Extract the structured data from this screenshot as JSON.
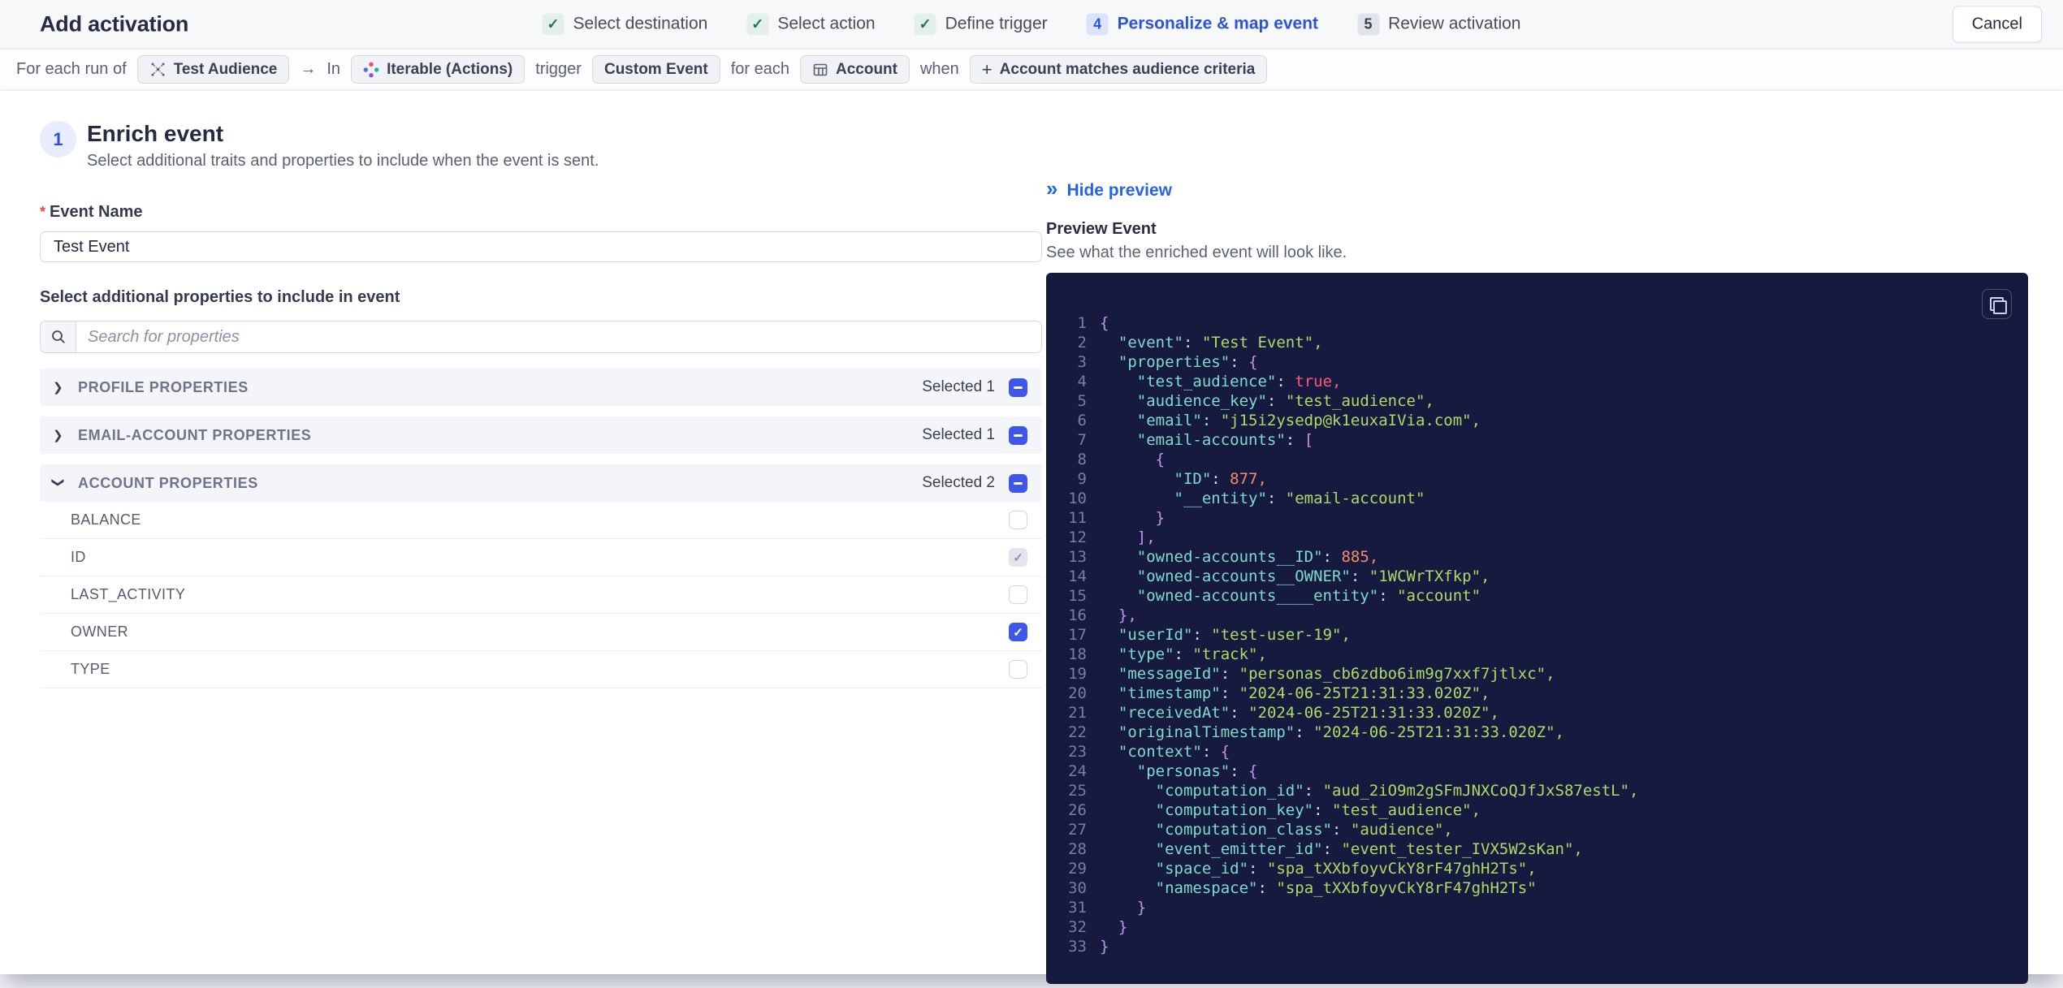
{
  "colors": {
    "accent_blue": "#2b54d8",
    "link_blue": "#2563ea",
    "checkbox_blue": "#3e56ea",
    "success_green": "#1e7a4e",
    "required_red": "#e5484d",
    "code_background": "#161a3e",
    "code_key": "#7fdbca",
    "code_string": "#addb67",
    "code_punctuation": "#c792ea",
    "code_number": "#f78c6c",
    "code_boolean": "#ff5874"
  },
  "header": {
    "title": "Add activation",
    "cancel_label": "Cancel",
    "steps": [
      {
        "label": "Select destination",
        "state": "done"
      },
      {
        "label": "Select action",
        "state": "done"
      },
      {
        "label": "Define trigger",
        "state": "done"
      },
      {
        "label": "Personalize & map event",
        "state": "active",
        "number": "4"
      },
      {
        "label": "Review activation",
        "state": "upcoming",
        "number": "5"
      }
    ]
  },
  "breadcrumb": {
    "segments": [
      {
        "type": "text",
        "text": "For each run of"
      },
      {
        "type": "chip",
        "text": "Test Audience",
        "icon": "audience-icon"
      },
      {
        "type": "text",
        "text": "→"
      },
      {
        "type": "text",
        "text": "In"
      },
      {
        "type": "chip",
        "text": "Iterable (Actions)",
        "icon": "iterable-icon"
      },
      {
        "type": "text",
        "text": "trigger"
      },
      {
        "type": "chip",
        "text": "Custom Event"
      },
      {
        "type": "text",
        "text": "for each"
      },
      {
        "type": "chip",
        "text": "Account",
        "icon": "table-icon"
      },
      {
        "type": "text",
        "text": "when"
      },
      {
        "type": "chip",
        "text": "Account matches audience criteria",
        "icon": "plus-icon"
      }
    ]
  },
  "enrich": {
    "step_number": "1",
    "required_mark": "*",
    "title": "Enrich event",
    "subtitle": "Select additional traits and properties to include when the event is sent.",
    "event_name_label": "Event Name",
    "event_name_value": "Test Event",
    "properties_label": "Select additional properties to include in event",
    "search_placeholder": "Search for properties",
    "sections": [
      {
        "label": "PROFILE PROPERTIES",
        "selected_text": "Selected 1",
        "expanded": false
      },
      {
        "label": "EMAIL-ACCOUNT PROPERTIES",
        "selected_text": "Selected 1",
        "expanded": false
      },
      {
        "label": "ACCOUNT PROPERTIES",
        "selected_text": "Selected 2",
        "expanded": true,
        "properties": [
          {
            "label": "BALANCE",
            "checked": false,
            "disabled": false
          },
          {
            "label": "ID",
            "checked": true,
            "disabled": true
          },
          {
            "label": "LAST_ACTIVITY",
            "checked": false,
            "disabled": false
          },
          {
            "label": "OWNER",
            "checked": true,
            "disabled": false
          },
          {
            "label": "TYPE",
            "checked": false,
            "disabled": false
          }
        ]
      }
    ]
  },
  "preview": {
    "hide_label": "Hide preview",
    "title": "Preview Event",
    "subtitle": "See what the enriched event will look like.",
    "code_lines": [
      [
        [
          "p",
          "{"
        ]
      ],
      [
        [
          "w",
          "  "
        ],
        [
          "k",
          "\"event\""
        ],
        [
          "w",
          ": "
        ],
        [
          "s",
          "\"Test Event\","
        ]
      ],
      [
        [
          "w",
          "  "
        ],
        [
          "k",
          "\"properties\""
        ],
        [
          "w",
          ": "
        ],
        [
          "p",
          "{"
        ]
      ],
      [
        [
          "w",
          "    "
        ],
        [
          "k",
          "\"test_audience\""
        ],
        [
          "w",
          ": "
        ],
        [
          "b",
          "true,"
        ]
      ],
      [
        [
          "w",
          "    "
        ],
        [
          "k",
          "\"audience_key\""
        ],
        [
          "w",
          ": "
        ],
        [
          "s",
          "\"test_audience\","
        ]
      ],
      [
        [
          "w",
          "    "
        ],
        [
          "k",
          "\"email\""
        ],
        [
          "w",
          ": "
        ],
        [
          "s",
          "\"j15i2ysedp@k1euxaIVia.com\","
        ]
      ],
      [
        [
          "w",
          "    "
        ],
        [
          "k",
          "\"email-accounts\""
        ],
        [
          "w",
          ": "
        ],
        [
          "p",
          "["
        ]
      ],
      [
        [
          "w",
          "      "
        ],
        [
          "p",
          "{"
        ]
      ],
      [
        [
          "w",
          "        "
        ],
        [
          "k",
          "\"ID\""
        ],
        [
          "w",
          ": "
        ],
        [
          "n",
          "877,"
        ]
      ],
      [
        [
          "w",
          "        "
        ],
        [
          "k",
          "\"__entity\""
        ],
        [
          "w",
          ": "
        ],
        [
          "s",
          "\"email-account\""
        ]
      ],
      [
        [
          "w",
          "      "
        ],
        [
          "p",
          "}"
        ]
      ],
      [
        [
          "w",
          "    "
        ],
        [
          "p",
          "],"
        ]
      ],
      [
        [
          "w",
          "    "
        ],
        [
          "k",
          "\"owned-accounts__ID\""
        ],
        [
          "w",
          ": "
        ],
        [
          "n",
          "885,"
        ]
      ],
      [
        [
          "w",
          "    "
        ],
        [
          "k",
          "\"owned-accounts__OWNER\""
        ],
        [
          "w",
          ": "
        ],
        [
          "s",
          "\"1WCWrTXfkp\","
        ]
      ],
      [
        [
          "w",
          "    "
        ],
        [
          "k",
          "\"owned-accounts____entity\""
        ],
        [
          "w",
          ": "
        ],
        [
          "s",
          "\"account\""
        ]
      ],
      [
        [
          "w",
          "  "
        ],
        [
          "p",
          "},"
        ]
      ],
      [
        [
          "w",
          "  "
        ],
        [
          "k",
          "\"userId\""
        ],
        [
          "w",
          ": "
        ],
        [
          "s",
          "\"test-user-19\","
        ]
      ],
      [
        [
          "w",
          "  "
        ],
        [
          "k",
          "\"type\""
        ],
        [
          "w",
          ": "
        ],
        [
          "s",
          "\"track\","
        ]
      ],
      [
        [
          "w",
          "  "
        ],
        [
          "k",
          "\"messageId\""
        ],
        [
          "w",
          ": "
        ],
        [
          "s",
          "\"personas_cb6zdbo6im9g7xxf7jtlxc\","
        ]
      ],
      [
        [
          "w",
          "  "
        ],
        [
          "k",
          "\"timestamp\""
        ],
        [
          "w",
          ": "
        ],
        [
          "s",
          "\"2024-06-25T21:31:33.020Z\","
        ]
      ],
      [
        [
          "w",
          "  "
        ],
        [
          "k",
          "\"receivedAt\""
        ],
        [
          "w",
          ": "
        ],
        [
          "s",
          "\"2024-06-25T21:31:33.020Z\","
        ]
      ],
      [
        [
          "w",
          "  "
        ],
        [
          "k",
          "\"originalTimestamp\""
        ],
        [
          "w",
          ": "
        ],
        [
          "s",
          "\"2024-06-25T21:31:33.020Z\","
        ]
      ],
      [
        [
          "w",
          "  "
        ],
        [
          "k",
          "\"context\""
        ],
        [
          "w",
          ": "
        ],
        [
          "p",
          "{"
        ]
      ],
      [
        [
          "w",
          "    "
        ],
        [
          "k",
          "\"personas\""
        ],
        [
          "w",
          ": "
        ],
        [
          "p",
          "{"
        ]
      ],
      [
        [
          "w",
          "      "
        ],
        [
          "k",
          "\"computation_id\""
        ],
        [
          "w",
          ": "
        ],
        [
          "s",
          "\"aud_2iO9m2gSFmJNXCoQJfJxS87estL\","
        ]
      ],
      [
        [
          "w",
          "      "
        ],
        [
          "k",
          "\"computation_key\""
        ],
        [
          "w",
          ": "
        ],
        [
          "s",
          "\"test_audience\","
        ]
      ],
      [
        [
          "w",
          "      "
        ],
        [
          "k",
          "\"computation_class\""
        ],
        [
          "w",
          ": "
        ],
        [
          "s",
          "\"audience\","
        ]
      ],
      [
        [
          "w",
          "      "
        ],
        [
          "k",
          "\"event_emitter_id\""
        ],
        [
          "w",
          ": "
        ],
        [
          "s",
          "\"event_tester_IVX5W2sKan\","
        ]
      ],
      [
        [
          "w",
          "      "
        ],
        [
          "k",
          "\"space_id\""
        ],
        [
          "w",
          ": "
        ],
        [
          "s",
          "\"spa_tXXbfoyvCkY8rF47ghH2Ts\","
        ]
      ],
      [
        [
          "w",
          "      "
        ],
        [
          "k",
          "\"namespace\""
        ],
        [
          "w",
          ": "
        ],
        [
          "s",
          "\"spa_tXXbfoyvCkY8rF47ghH2Ts\""
        ]
      ],
      [
        [
          "w",
          "    "
        ],
        [
          "p",
          "}"
        ]
      ],
      [
        [
          "w",
          "  "
        ],
        [
          "p",
          "}"
        ]
      ],
      [
        [
          "p",
          "}"
        ]
      ]
    ]
  }
}
